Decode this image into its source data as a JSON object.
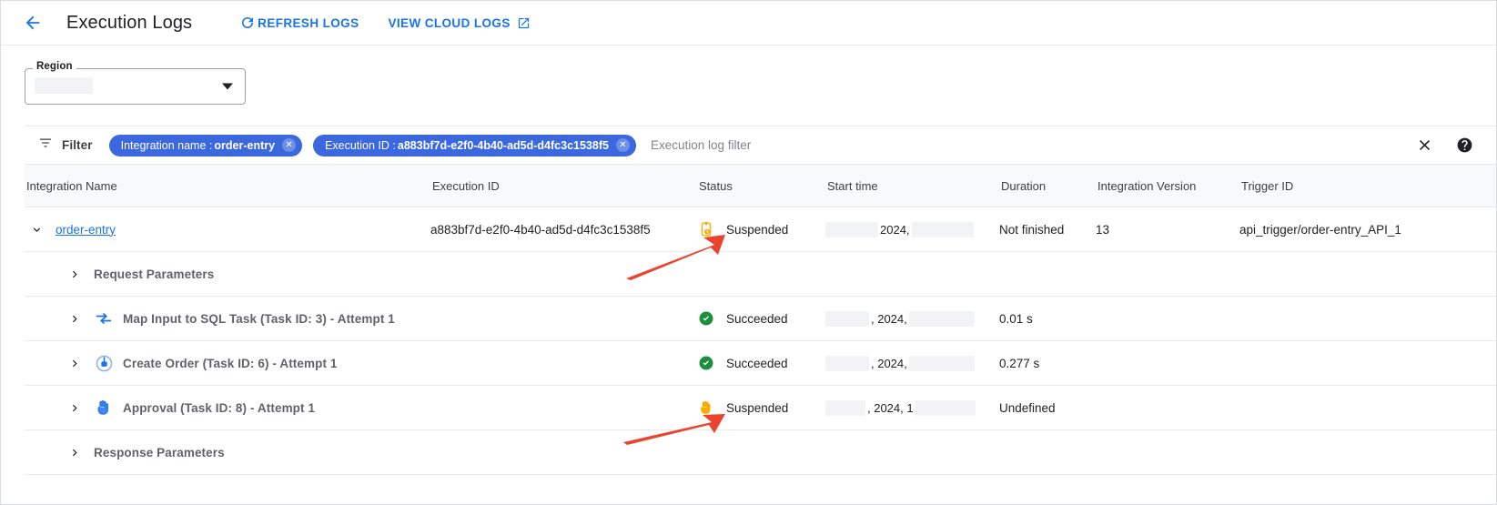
{
  "appbar": {
    "back_icon": "arrow-back-icon",
    "title": "Execution Logs",
    "refresh_label": "REFRESH LOGS",
    "refresh_icon": "refresh-icon",
    "cloud_logs_label": "VIEW CLOUD LOGS",
    "cloud_logs_icon": "open-in-new-icon"
  },
  "region": {
    "legend": "Region",
    "value": "",
    "dropdown_icon": "chevron-down-icon"
  },
  "filter": {
    "icon": "filter-list-icon",
    "label": "Filter",
    "chips": [
      {
        "label": "Integration name :",
        "value": "order-entry",
        "remove_icon": "chip-remove-icon"
      },
      {
        "label": "Execution ID :",
        "value": "a883bf7d-e2f0-4b40-ad5d-d4fc3c1538f5",
        "remove_icon": "chip-remove-icon"
      }
    ],
    "input_value": "",
    "placeholder": "Execution log filter",
    "clear_icon": "close-icon",
    "help_icon": "help-icon"
  },
  "table": {
    "headers": [
      "Integration Name",
      "Execution ID",
      "Status",
      "Start time",
      "Duration",
      "Integration Version",
      "Trigger ID"
    ],
    "rows": [
      {
        "type": "parent",
        "caret_icon": "chevron-down-icon",
        "name": "order-entry",
        "execution_id": "a883bf7d-e2f0-4b40-ad5d-d4fc3c1538f5",
        "status": "Suspended",
        "status_icon": "suspended-clipboard-icon",
        "start_time": "2024,",
        "duration": "Not finished",
        "version": "13",
        "trigger_id": "api_trigger/order-entry_API_1"
      },
      {
        "type": "section",
        "caret_icon": "chevron-right-icon",
        "name": "Request Parameters",
        "execution_id": "",
        "status": "",
        "status_icon": "",
        "start_time": "",
        "duration": "",
        "version": "",
        "trigger_id": ""
      },
      {
        "type": "task",
        "caret_icon": "chevron-right-icon",
        "task_icon": "map-transform-icon",
        "name": "Map Input to SQL Task (Task ID: 3) - Attempt 1",
        "execution_id": "",
        "status": "Succeeded",
        "status_icon": "check-circle-icon",
        "start_time": ", 2024,",
        "duration": "0.01 s",
        "version": "",
        "trigger_id": ""
      },
      {
        "type": "task",
        "caret_icon": "chevron-right-icon",
        "task_icon": "connector-icon",
        "name": "Create Order (Task ID: 6) - Attempt 1",
        "execution_id": "",
        "status": "Succeeded",
        "status_icon": "check-circle-icon",
        "start_time": ", 2024,",
        "duration": "0.277 s",
        "version": "",
        "trigger_id": ""
      },
      {
        "type": "task",
        "caret_icon": "chevron-right-icon",
        "task_icon": "approval-hand-icon",
        "name": "Approval (Task ID: 8) - Attempt 1",
        "execution_id": "",
        "status": "Suspended",
        "status_icon": "suspended-hand-icon",
        "start_time": ", 2024, 1",
        "duration": "Undefined",
        "version": "",
        "trigger_id": ""
      },
      {
        "type": "section",
        "caret_icon": "chevron-right-icon",
        "name": "Response Parameters",
        "execution_id": "",
        "status": "",
        "status_icon": "",
        "start_time": "",
        "duration": "",
        "version": "",
        "trigger_id": ""
      }
    ]
  },
  "annotations": [
    {
      "name": "arrow-pointing-to-parent-suspended-status",
      "color": "#e8442e"
    },
    {
      "name": "arrow-pointing-to-approval-suspended-status",
      "color": "#e8442e"
    }
  ],
  "colors": {
    "accent_blue": "#1a73e8",
    "chip_blue": "#3b68df",
    "success_green": "#1e8e3e",
    "suspended_amber": "#f9ab00",
    "annotation_red": "#e8442e"
  }
}
